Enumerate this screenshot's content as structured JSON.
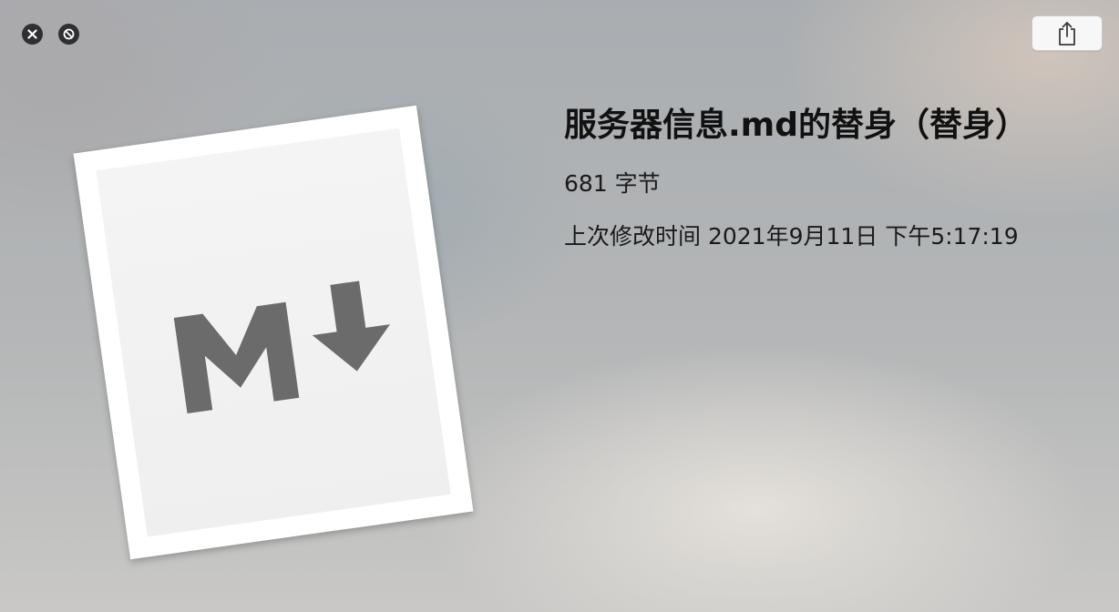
{
  "window": {
    "close_icon": "close-x-icon",
    "fullscreen_icon": "no-entry-icon",
    "share_icon": "share-icon"
  },
  "preview": {
    "icon": "markdown-file-icon",
    "glyph": "markdown-logo-M-down-arrow"
  },
  "file": {
    "name": "服务器信息.md的替身（替身）",
    "size": "681 字节",
    "modified": "上次修改时间 2021年9月11日 下午5:17:19"
  },
  "colors": {
    "glyph": "#6b6b6b",
    "title_text": "#111111",
    "button_dark": "#2d2f32"
  }
}
